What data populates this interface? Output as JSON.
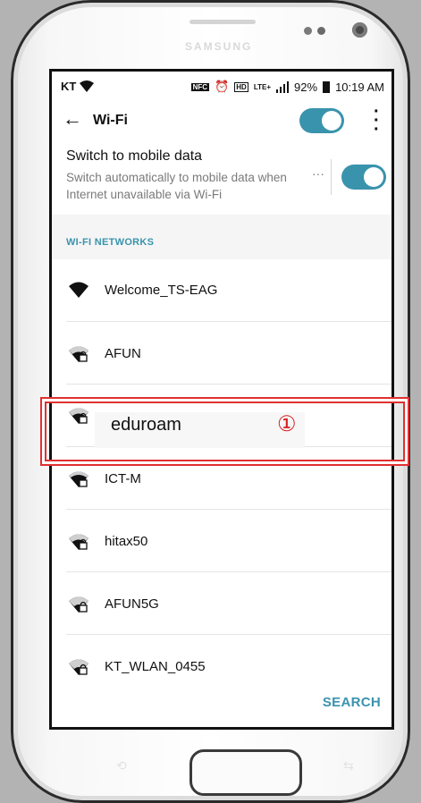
{
  "status_bar": {
    "carrier": "KT",
    "nfc": "NFC",
    "hd": "HD",
    "lte": "LTE+",
    "battery": "92%",
    "time": "10:19 AM"
  },
  "appbar": {
    "title": "Wi-Fi",
    "wifi_enabled": true
  },
  "mobile_data": {
    "title": "Switch to mobile data",
    "subtitle": "Switch automatically to mobile data when Internet unavailable via Wi-Fi",
    "more": "···",
    "enabled": true
  },
  "section": {
    "label": "WI-FI NETWORKS"
  },
  "networks": [
    {
      "name": "Welcome_TS-EAG",
      "secured": false
    },
    {
      "name": "AFUN",
      "secured": true
    },
    {
      "name": "eduroam",
      "secured": true
    },
    {
      "name": "ICT-M",
      "secured": true
    },
    {
      "name": "hitax50",
      "secured": true
    },
    {
      "name": "AFUN5G",
      "secured": true
    },
    {
      "name": "KT_WLAN_0455",
      "secured": true
    }
  ],
  "bottom": {
    "search_label": "SEARCH"
  },
  "annotation": {
    "number": "①"
  },
  "colors": {
    "accent": "#3a93ad",
    "annotation": "#e03030"
  }
}
